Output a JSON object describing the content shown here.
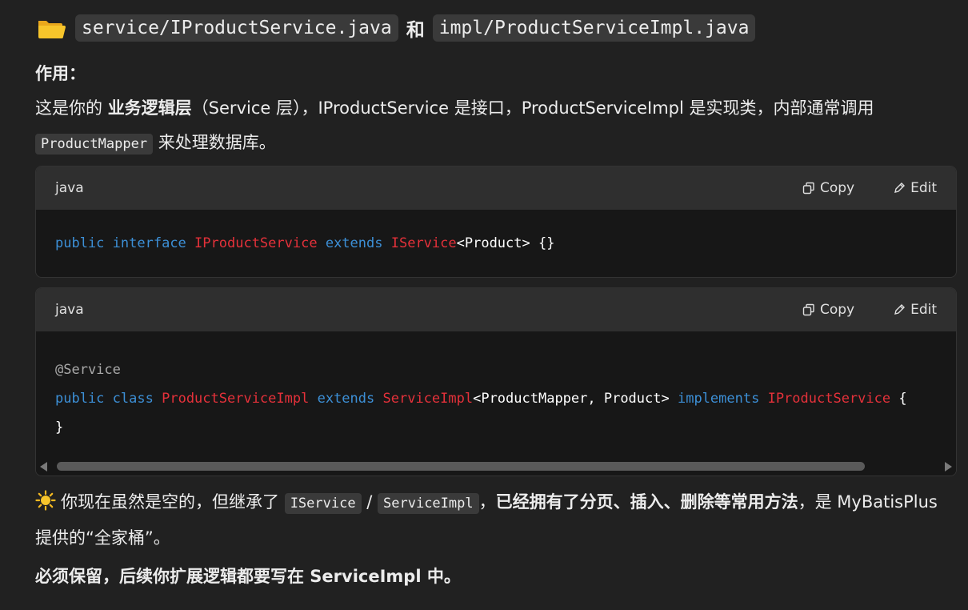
{
  "heading": {
    "file1": "service/IProductService.java",
    "joiner": "和",
    "file2": "impl/ProductServiceImpl.java"
  },
  "role_label": "作用：",
  "para1": {
    "t1": "这是你的 ",
    "bold1": "业务逻辑层",
    "t2": "（Service 层），IProductService 是接口，ProductServiceImpl 是实现类，内部通常调用 ",
    "code1": "ProductMapper",
    "t3": " 来处理数据库。"
  },
  "code_blocks": [
    {
      "lang": "java",
      "copy_label": "Copy",
      "edit_label": "Edit",
      "lines": [
        [
          {
            "cls": "kw",
            "text": "public"
          },
          {
            "cls": "pl",
            "text": " "
          },
          {
            "cls": "kw",
            "text": "interface"
          },
          {
            "cls": "pl",
            "text": " "
          },
          {
            "cls": "ty",
            "text": "IProductService"
          },
          {
            "cls": "pl",
            "text": " "
          },
          {
            "cls": "kw",
            "text": "extends"
          },
          {
            "cls": "pl",
            "text": " "
          },
          {
            "cls": "ty",
            "text": "IService"
          },
          {
            "cls": "pl",
            "text": "<Product> {}"
          }
        ]
      ]
    },
    {
      "lang": "java",
      "copy_label": "Copy",
      "edit_label": "Edit",
      "lines": [
        [
          {
            "cls": "an",
            "text": "@Service"
          }
        ],
        [
          {
            "cls": "kw",
            "text": "public"
          },
          {
            "cls": "pl",
            "text": " "
          },
          {
            "cls": "kw",
            "text": "class"
          },
          {
            "cls": "pl",
            "text": " "
          },
          {
            "cls": "ty",
            "text": "ProductServiceImpl"
          },
          {
            "cls": "pl",
            "text": " "
          },
          {
            "cls": "kw",
            "text": "extends"
          },
          {
            "cls": "pl",
            "text": " "
          },
          {
            "cls": "ty",
            "text": "ServiceImpl"
          },
          {
            "cls": "pl",
            "text": "<ProductMapper, Product> "
          },
          {
            "cls": "kw",
            "text": "implements"
          },
          {
            "cls": "pl",
            "text": " "
          },
          {
            "cls": "ty",
            "text": "IProductService"
          },
          {
            "cls": "pl",
            "text": " {"
          }
        ],
        [
          {
            "cls": "pl",
            "text": "}"
          }
        ]
      ]
    }
  ],
  "para2": {
    "t1": "你现在虽然是空的，但继承了 ",
    "code1": "IService",
    "sep": " / ",
    "code2": "ServiceImpl",
    "t2": "，",
    "bold1": "已经拥有了分页、插入、删除等常用方法",
    "t3": "，是 MyBatisPlus 提供的“全家桶”。"
  },
  "final_note": "必须保留，后续你扩展逻辑都要写在 ServiceImpl 中。",
  "colors": {
    "background": "#212121",
    "keyword": "#3c8fd6",
    "type": "#e5313a",
    "annotation": "#a9a9a9"
  },
  "icons": [
    "folder-icon",
    "copy-icon",
    "edit-icon",
    "sun-icon"
  ]
}
